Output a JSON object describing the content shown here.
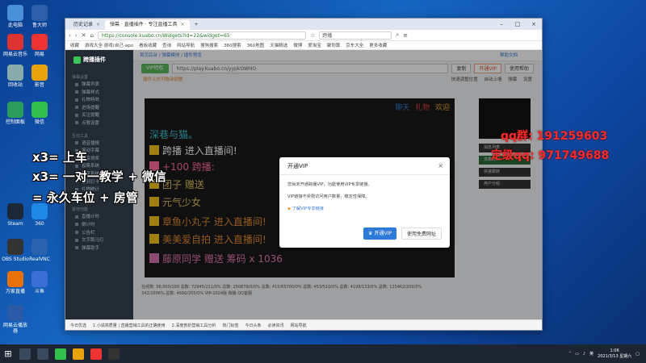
{
  "desktop": {
    "icons": [
      {
        "label": "此电脑",
        "color": "#4a90d9"
      },
      {
        "label": "鲁大师",
        "color": "#2d5fa8"
      },
      {
        "label": "网易云音乐",
        "color": "#d33"
      },
      {
        "label": "网易",
        "color": "#e33"
      },
      {
        "label": "回收站",
        "color": "#8aa"
      },
      {
        "label": "影音",
        "color": "#e8a20a"
      },
      {
        "label": "控制面板",
        "color": "#2a9d5c"
      },
      {
        "label": "微信",
        "color": "#2fbf4a"
      },
      {
        "label": "Steam",
        "color": "#1b2838"
      },
      {
        "label": "360",
        "color": "#1e88e5"
      },
      {
        "label": "OBS Studio",
        "color": "#333"
      },
      {
        "label": "RealVNC",
        "color": "#2a62b0"
      },
      {
        "label": "万家直播",
        "color": "#e8710a"
      },
      {
        "label": "斗鱼",
        "color": "#3b6fd6"
      },
      {
        "label": "网易云播放器",
        "color": "#2b5aa8"
      }
    ]
  },
  "browser": {
    "tabs": [
      {
        "label": "历史记录",
        "active": false
      },
      {
        "label": "弹幕 · 直播插件 · 专注直播工具",
        "active": true
      }
    ],
    "new_tab": "+",
    "address": "https://console.kuabo.cn/Widgets?id=22&widget=65",
    "search_value": "跨播",
    "bookmarks": [
      "收藏",
      "游戏大全·游戏(自己-apo",
      "看板收藏",
      "查询",
      "网站导航",
      "搜狗搜索",
      "360搜索",
      "360地图",
      "天猫精选",
      "微博",
      "爱淘宝",
      "聚划算",
      "京东大全",
      "更多收藏"
    ]
  },
  "app": {
    "brand": "跨播插件",
    "nav_sections": [
      {
        "title": "弹幕设置",
        "items": [
          "弹幕列表",
          "弹幕样式",
          "礼物特效",
          "进场提醒",
          "关注提醒",
          "点歌设置"
        ]
      },
      {
        "title": "互动工具",
        "items": [
          "语音播报",
          "滚动字幕",
          "分享得奖",
          "投票系统",
          "抽奖系统",
          "签到打卡",
          "礼物统计",
          "排行榜"
        ]
      },
      {
        "title": "其他功能",
        "items": [
          "直播计时",
          "倒计时",
          "公告栏",
          "文字跑马灯",
          "弹幕助手"
        ]
      }
    ],
    "breadcrumb": "首页后台 / 弹幕模块 / 插件预览",
    "breadcrumb_right": "帮助文档",
    "user_label": "用户 Ruby",
    "vip_button": "VIP特权",
    "url_value": "https://play.kuabo.cn/yypkOWHO",
    "copy_button": "复制",
    "vip_copy_button": "开通VIP",
    "help_button": "使用帮助",
    "hint": "插件上方可拖动调整",
    "options": [
      "快速调整位置",
      "自动上墙",
      "弹幕",
      "设置"
    ],
    "preview": {
      "top_tags": [
        "聊天",
        "礼物",
        "欢迎"
      ],
      "lines": [
        {
          "text": "深巷与猫。",
          "color": "#3ec4d6"
        },
        {
          "text": "跨播 进入直播间!",
          "color": "#ffffff"
        },
        {
          "text": "+100 跨播:",
          "color": "#ff6aa0"
        },
        {
          "text": "团子 赠送",
          "color": "#e0c060"
        },
        {
          "text": "元气少女",
          "color": "#e0c060"
        },
        {
          "text": "章鱼小丸子 进入直播间!",
          "color": "#e08a30"
        },
        {
          "text": "美美爱自拍 进入直播间!",
          "color": "#e08a30"
        },
        {
          "text": "藤原同学 赠送 筹码 x 1036",
          "color": "#e07ab0"
        }
      ]
    },
    "side_buttons": [
      "消息列表",
      "流量统计",
      "快速跳转",
      "用户分组"
    ],
    "status_lines": [
      "在线数: 36,000/200  总数: 72945/211/0%  总数: 250879/0/0%  总数: 415/65700/0%  总数: 453/510/0%  总数: 4198/133/0%  总数: 125462/200/0%",
      "342/1006%  总数: 4690/205/0%  VIP-2024版  跨播  QQ客服"
    ]
  },
  "modal": {
    "title": "开通VIP",
    "close": "×",
    "line1": "您尚未开通跨播VIP，功能使用VIP专享链接。",
    "line2": "VIP链接不受限访问用户数量，稳定性保障。",
    "link": "了解VIP专享链接",
    "primary": "开通VIP",
    "secondary": "使用免费网址"
  },
  "browser_bottom": [
    "今日优选",
    "1.小说高质量 | 直播营销工具的正确使用",
    "2.深度剖析营销工具分析",
    "热门标签",
    "今日头条",
    "必读资讯",
    "网站导航"
  ],
  "stream_overlay": {
    "left_lines": [
      "x3= 上车",
      "x3= 一对一教学 + 微信",
      "= 永久车位 + 房管"
    ],
    "right_lines": [
      "qq群: 191259603",
      "定级qq: 971749688"
    ]
  },
  "taskbar": {
    "time": "1:06",
    "date": "2021/3/13 星期六",
    "lang": "英"
  }
}
